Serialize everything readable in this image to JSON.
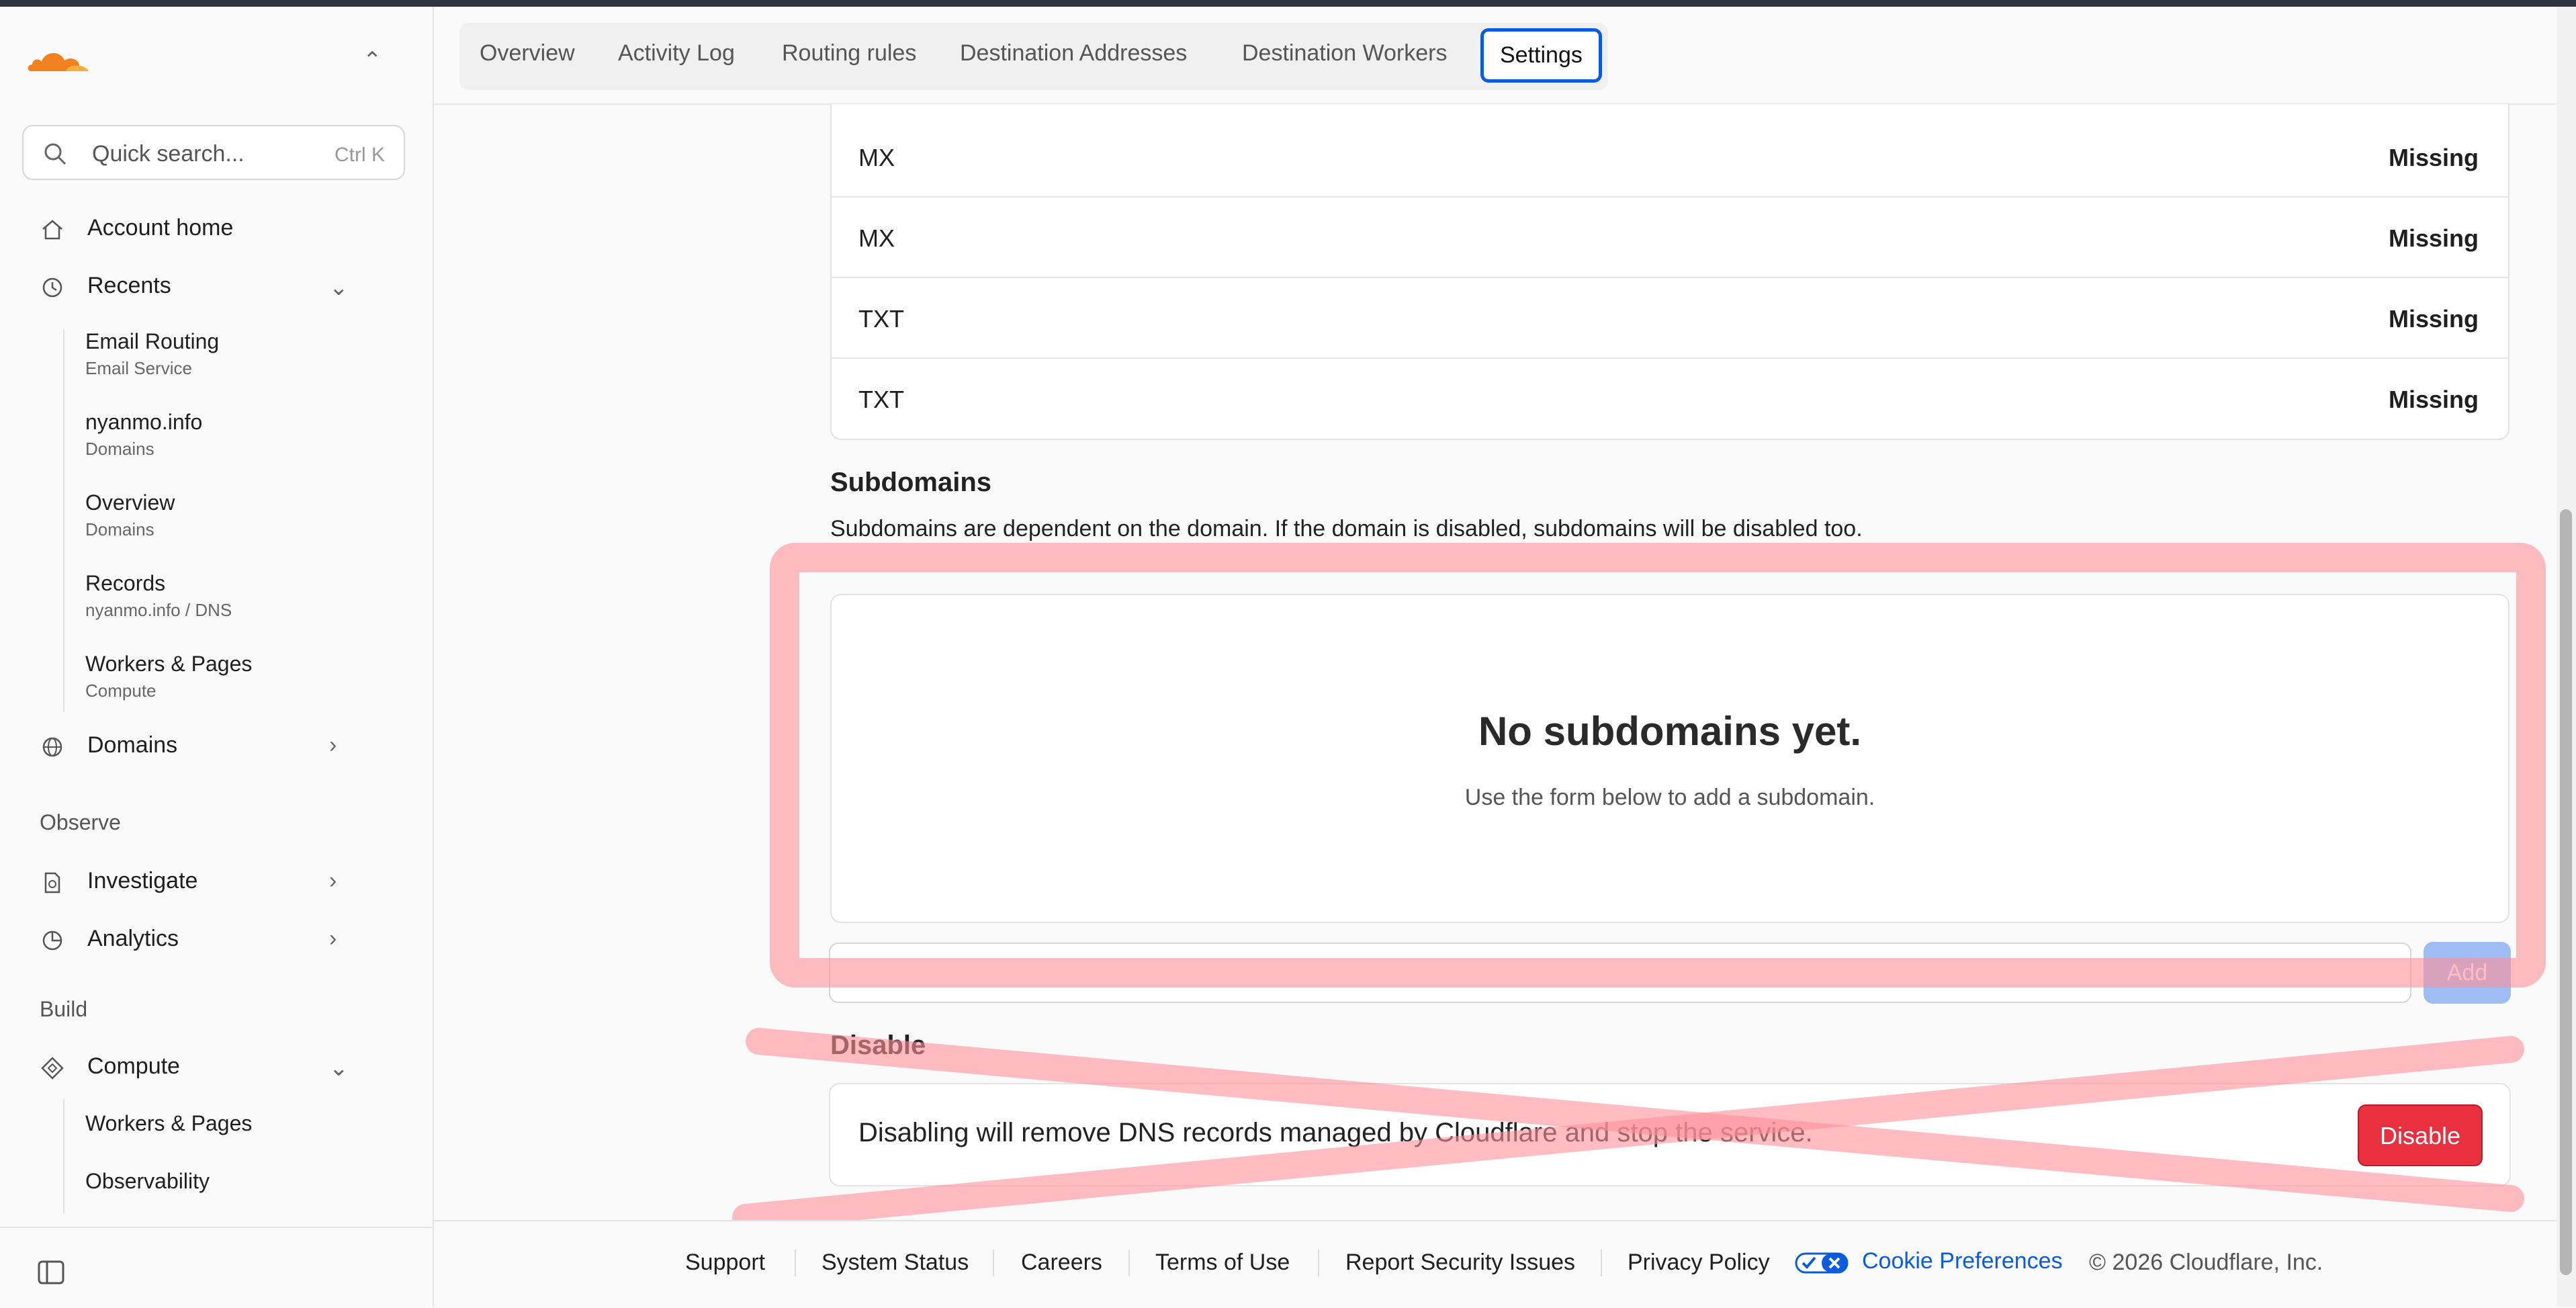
{
  "tabs": [
    {
      "label": "Overview"
    },
    {
      "label": "Activity Log"
    },
    {
      "label": "Routing rules"
    },
    {
      "label": "Destination Addresses"
    },
    {
      "label": "Destination Workers"
    },
    {
      "label": "Settings",
      "active": true
    }
  ],
  "sidebar": {
    "search_placeholder": "Quick search...",
    "search_shortcut": "Ctrl K",
    "account_home": "Account home",
    "recents": "Recents",
    "recent_items": [
      {
        "title": "Email Routing",
        "subtitle": "Email Service"
      },
      {
        "title": "nyanmo.info",
        "subtitle": "Domains"
      },
      {
        "title": "Overview",
        "subtitle": "Domains"
      },
      {
        "title": "Records",
        "subtitle": "nyanmo.info  /  DNS"
      },
      {
        "title": "Workers & Pages",
        "subtitle": "Compute"
      }
    ],
    "domains": "Domains",
    "observe_label": "Observe",
    "investigate": "Investigate",
    "analytics": "Analytics",
    "build_label": "Build",
    "compute": "Compute",
    "compute_items": [
      {
        "title": "Workers & Pages"
      },
      {
        "title": "Observability"
      }
    ]
  },
  "records": [
    {
      "type": "MX",
      "status": "Missing"
    },
    {
      "type": "MX",
      "status": "Missing"
    },
    {
      "type": "TXT",
      "status": "Missing"
    },
    {
      "type": "TXT",
      "status": "Missing"
    }
  ],
  "subdomains": {
    "heading": "Subdomains",
    "description": "Subdomains are dependent on the domain. If the domain is disabled, subdomains will be disabled too.",
    "empty_title": "No subdomains yet.",
    "empty_desc": "Use the form below to add a subdomain.",
    "add_label": "Add"
  },
  "disable": {
    "heading": "Disable",
    "description": "Disabling will remove DNS records managed by Cloudflare and stop the service.",
    "button": "Disable"
  },
  "footer": {
    "links": [
      "Support",
      "System Status",
      "Careers",
      "Terms of Use",
      "Report Security Issues",
      "Privacy Policy"
    ],
    "cookie": "Cookie Preferences",
    "copyright": "© 2026 Cloudflare, Inc."
  },
  "colors": {
    "accent": "#0a5be0",
    "danger": "#e8303f",
    "brand_orange": "#f48120",
    "annotation": "#ff8f98"
  }
}
